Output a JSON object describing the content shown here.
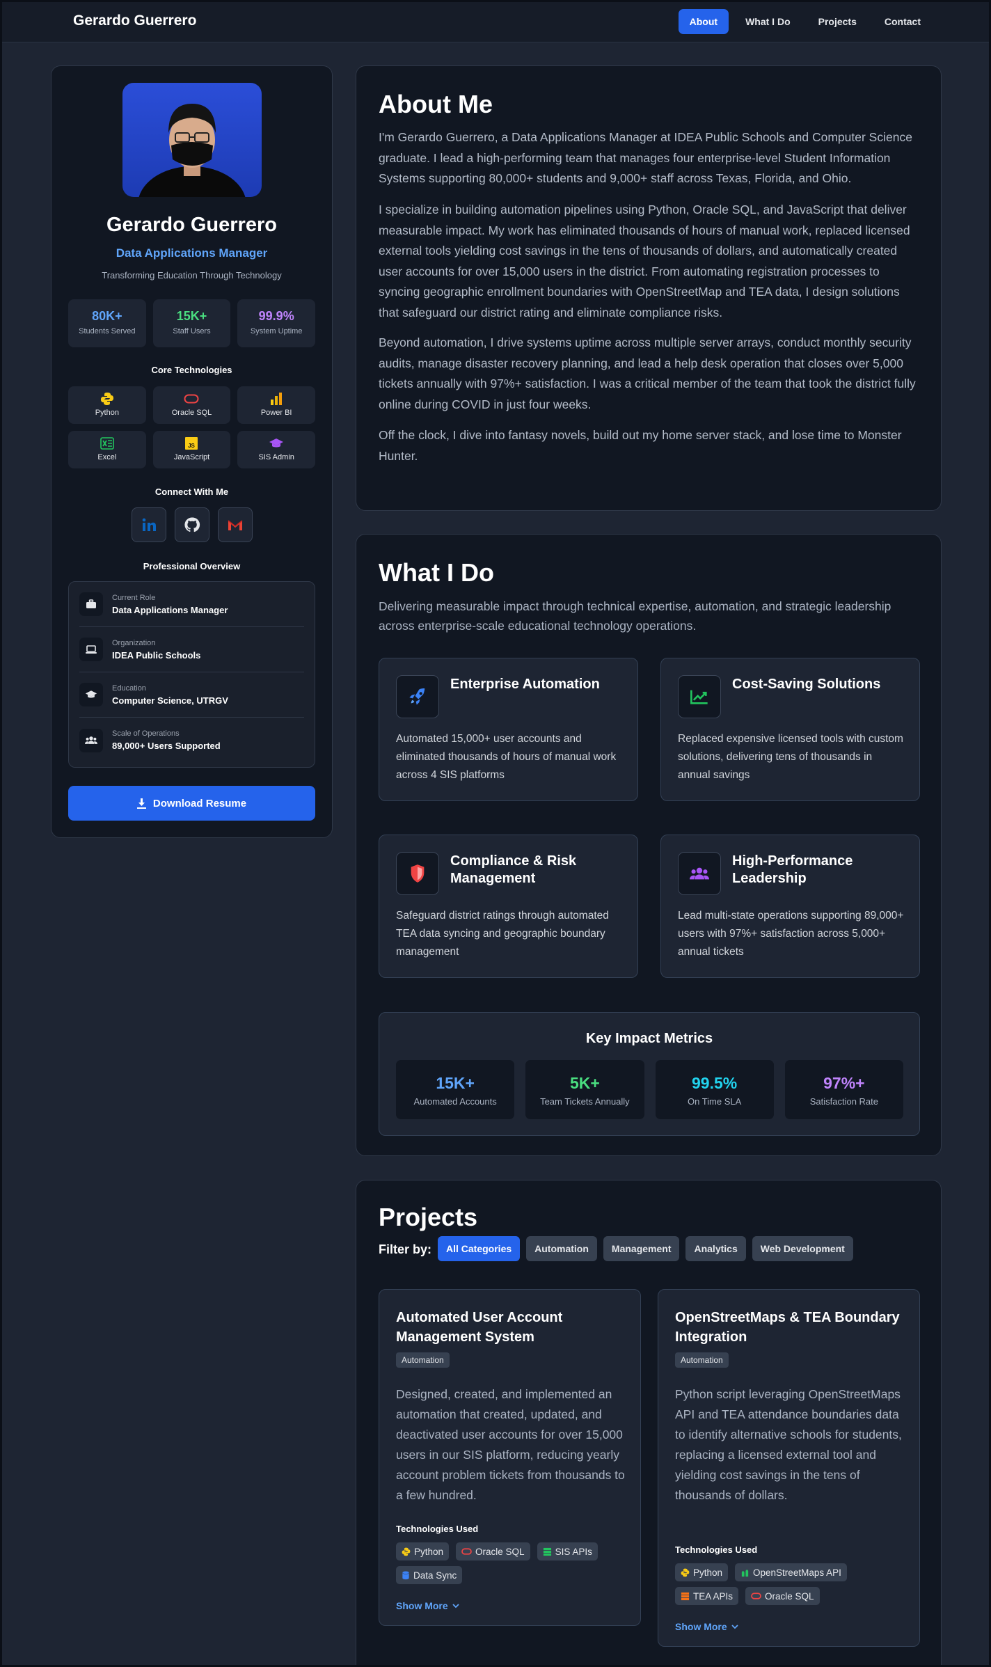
{
  "nav": {
    "brand": "Gerardo Guerrero",
    "links": [
      "About",
      "What I Do",
      "Projects",
      "Contact"
    ]
  },
  "sidebar": {
    "name": "Gerardo Guerrero",
    "title": "Data Applications Manager",
    "tagline": "Transforming Education Through Technology",
    "stats": [
      {
        "value": "80K+",
        "label": "Students Served",
        "color": "#60a5fa"
      },
      {
        "value": "15K+",
        "label": "Staff Users",
        "color": "#4ade80"
      },
      {
        "value": "99.9%",
        "label": "System Uptime",
        "color": "#c084fc"
      }
    ],
    "tech_heading": "Core Technologies",
    "tech": [
      {
        "label": "Python",
        "icon": "python-icon"
      },
      {
        "label": "Oracle SQL",
        "icon": "oracle-icon"
      },
      {
        "label": "Power BI",
        "icon": "powerbi-icon"
      },
      {
        "label": "Excel",
        "icon": "excel-icon"
      },
      {
        "label": "JavaScript",
        "icon": "javascript-icon"
      },
      {
        "label": "SIS Admin",
        "icon": "graduation-cap-icon"
      }
    ],
    "connect_heading": "Connect With Me",
    "overview_heading": "Professional Overview",
    "overview": [
      {
        "label": "Current Role",
        "value": "Data Applications Manager",
        "icon": "briefcase-icon"
      },
      {
        "label": "Organization",
        "value": "IDEA Public Schools",
        "icon": "laptop-icon"
      },
      {
        "label": "Education",
        "value": "Computer Science, UTRGV",
        "icon": "graduation-cap-icon"
      },
      {
        "label": "Scale of Operations",
        "value": "89,000+ Users Supported",
        "icon": "users-icon"
      }
    ],
    "resume_button": "Download Resume"
  },
  "about": {
    "heading": "About Me",
    "paragraphs": [
      "I'm Gerardo Guerrero, a Data Applications Manager at IDEA Public Schools and Computer Science graduate. I lead a high-performing team that manages four enterprise-level Student Information Systems supporting 80,000+ students and 9,000+ staff across Texas, Florida, and Ohio.",
      "I specialize in building automation pipelines using Python, Oracle SQL, and JavaScript that deliver measurable impact. My work has eliminated thousands of hours of manual work, replaced licensed external tools yielding cost savings in the tens of thousands of dollars, and automatically created user accounts for over 15,000 users in the district. From automating registration processes to syncing geographic enrollment boundaries with OpenStreetMap and TEA data, I design solutions that safeguard our district rating and eliminate compliance risks.",
      "Beyond automation, I drive systems uptime across multiple server arrays, conduct monthly security audits, manage disaster recovery planning, and lead a help desk operation that closes over 5,000 tickets annually with 97%+ satisfaction. I was a critical member of the team that took the district fully online during COVID in just four weeks.",
      "Off the clock, I dive into fantasy novels, build out my home server stack, and lose time to Monster Hunter."
    ]
  },
  "what": {
    "heading": "What I Do",
    "lead": "Delivering measurable impact through technical expertise, automation, and strategic leadership across enterprise-scale educational technology operations.",
    "services": [
      {
        "title": "Enterprise Automation",
        "desc": "Automated 15,000+ user accounts and eliminated thousands of hours of manual work across 4 SIS platforms",
        "icon": "rocket-icon",
        "color": "#3b82f6"
      },
      {
        "title": "Cost-Saving Solutions",
        "desc": "Replaced expensive licensed tools with custom solutions, delivering tens of thousands in annual savings",
        "icon": "chart-line-icon",
        "color": "#22c55e"
      },
      {
        "title": "Compliance & Risk Management",
        "desc": "Safeguard district ratings through automated TEA data syncing and geographic boundary management",
        "icon": "shield-icon",
        "color": "#ef4444"
      },
      {
        "title": "High-Performance Leadership",
        "desc": "Lead multi-state operations supporting 89,000+ users with 97%+ satisfaction across 5,000+ annual tickets",
        "icon": "users-icon",
        "color": "#a855f7"
      }
    ],
    "metrics_heading": "Key Impact Metrics",
    "metrics": [
      {
        "value": "15K+",
        "label": "Automated Accounts",
        "color": "#60a5fa"
      },
      {
        "value": "5K+",
        "label": "Team Tickets Annually",
        "color": "#4ade80"
      },
      {
        "value": "99.5%",
        "label": "On Time SLA",
        "color": "#22d3ee"
      },
      {
        "value": "97%+",
        "label": "Satisfaction Rate",
        "color": "#c084fc"
      }
    ]
  },
  "projects": {
    "heading": "Projects",
    "filter_label": "Filter by:",
    "filters": [
      "All Categories",
      "Automation",
      "Management",
      "Analytics",
      "Web Development"
    ],
    "tech_used_label": "Technologies Used",
    "show_more": "Show More",
    "items": [
      {
        "title": "Automated User Account Management System",
        "category": "Automation",
        "desc": "Designed, created, and implemented an automation that created, updated, and deactivated user accounts for over 15,000 users in our SIS platform, reducing yearly account problem tickets from thousands to a few hundred.",
        "tags": [
          {
            "label": "Python",
            "icon": "python-icon"
          },
          {
            "label": "Oracle SQL",
            "icon": "oracle-icon"
          },
          {
            "label": "SIS APIs",
            "icon": "server-icon"
          },
          {
            "label": "Data Sync",
            "icon": "database-icon"
          }
        ]
      },
      {
        "title": "OpenStreetMaps & TEA Boundary Integration",
        "category": "Automation",
        "desc": "Python script leveraging OpenStreetMaps API and TEA attendance boundaries data to identify alternative schools for students, replacing a licensed external tool and yielding cost savings in the tens of thousands of dollars.",
        "tags": [
          {
            "label": "Python",
            "icon": "python-icon"
          },
          {
            "label": "OpenStreetMaps API",
            "icon": "map-icon"
          },
          {
            "label": "TEA APIs",
            "icon": "server-icon"
          },
          {
            "label": "Oracle SQL",
            "icon": "oracle-icon"
          }
        ]
      }
    ]
  }
}
